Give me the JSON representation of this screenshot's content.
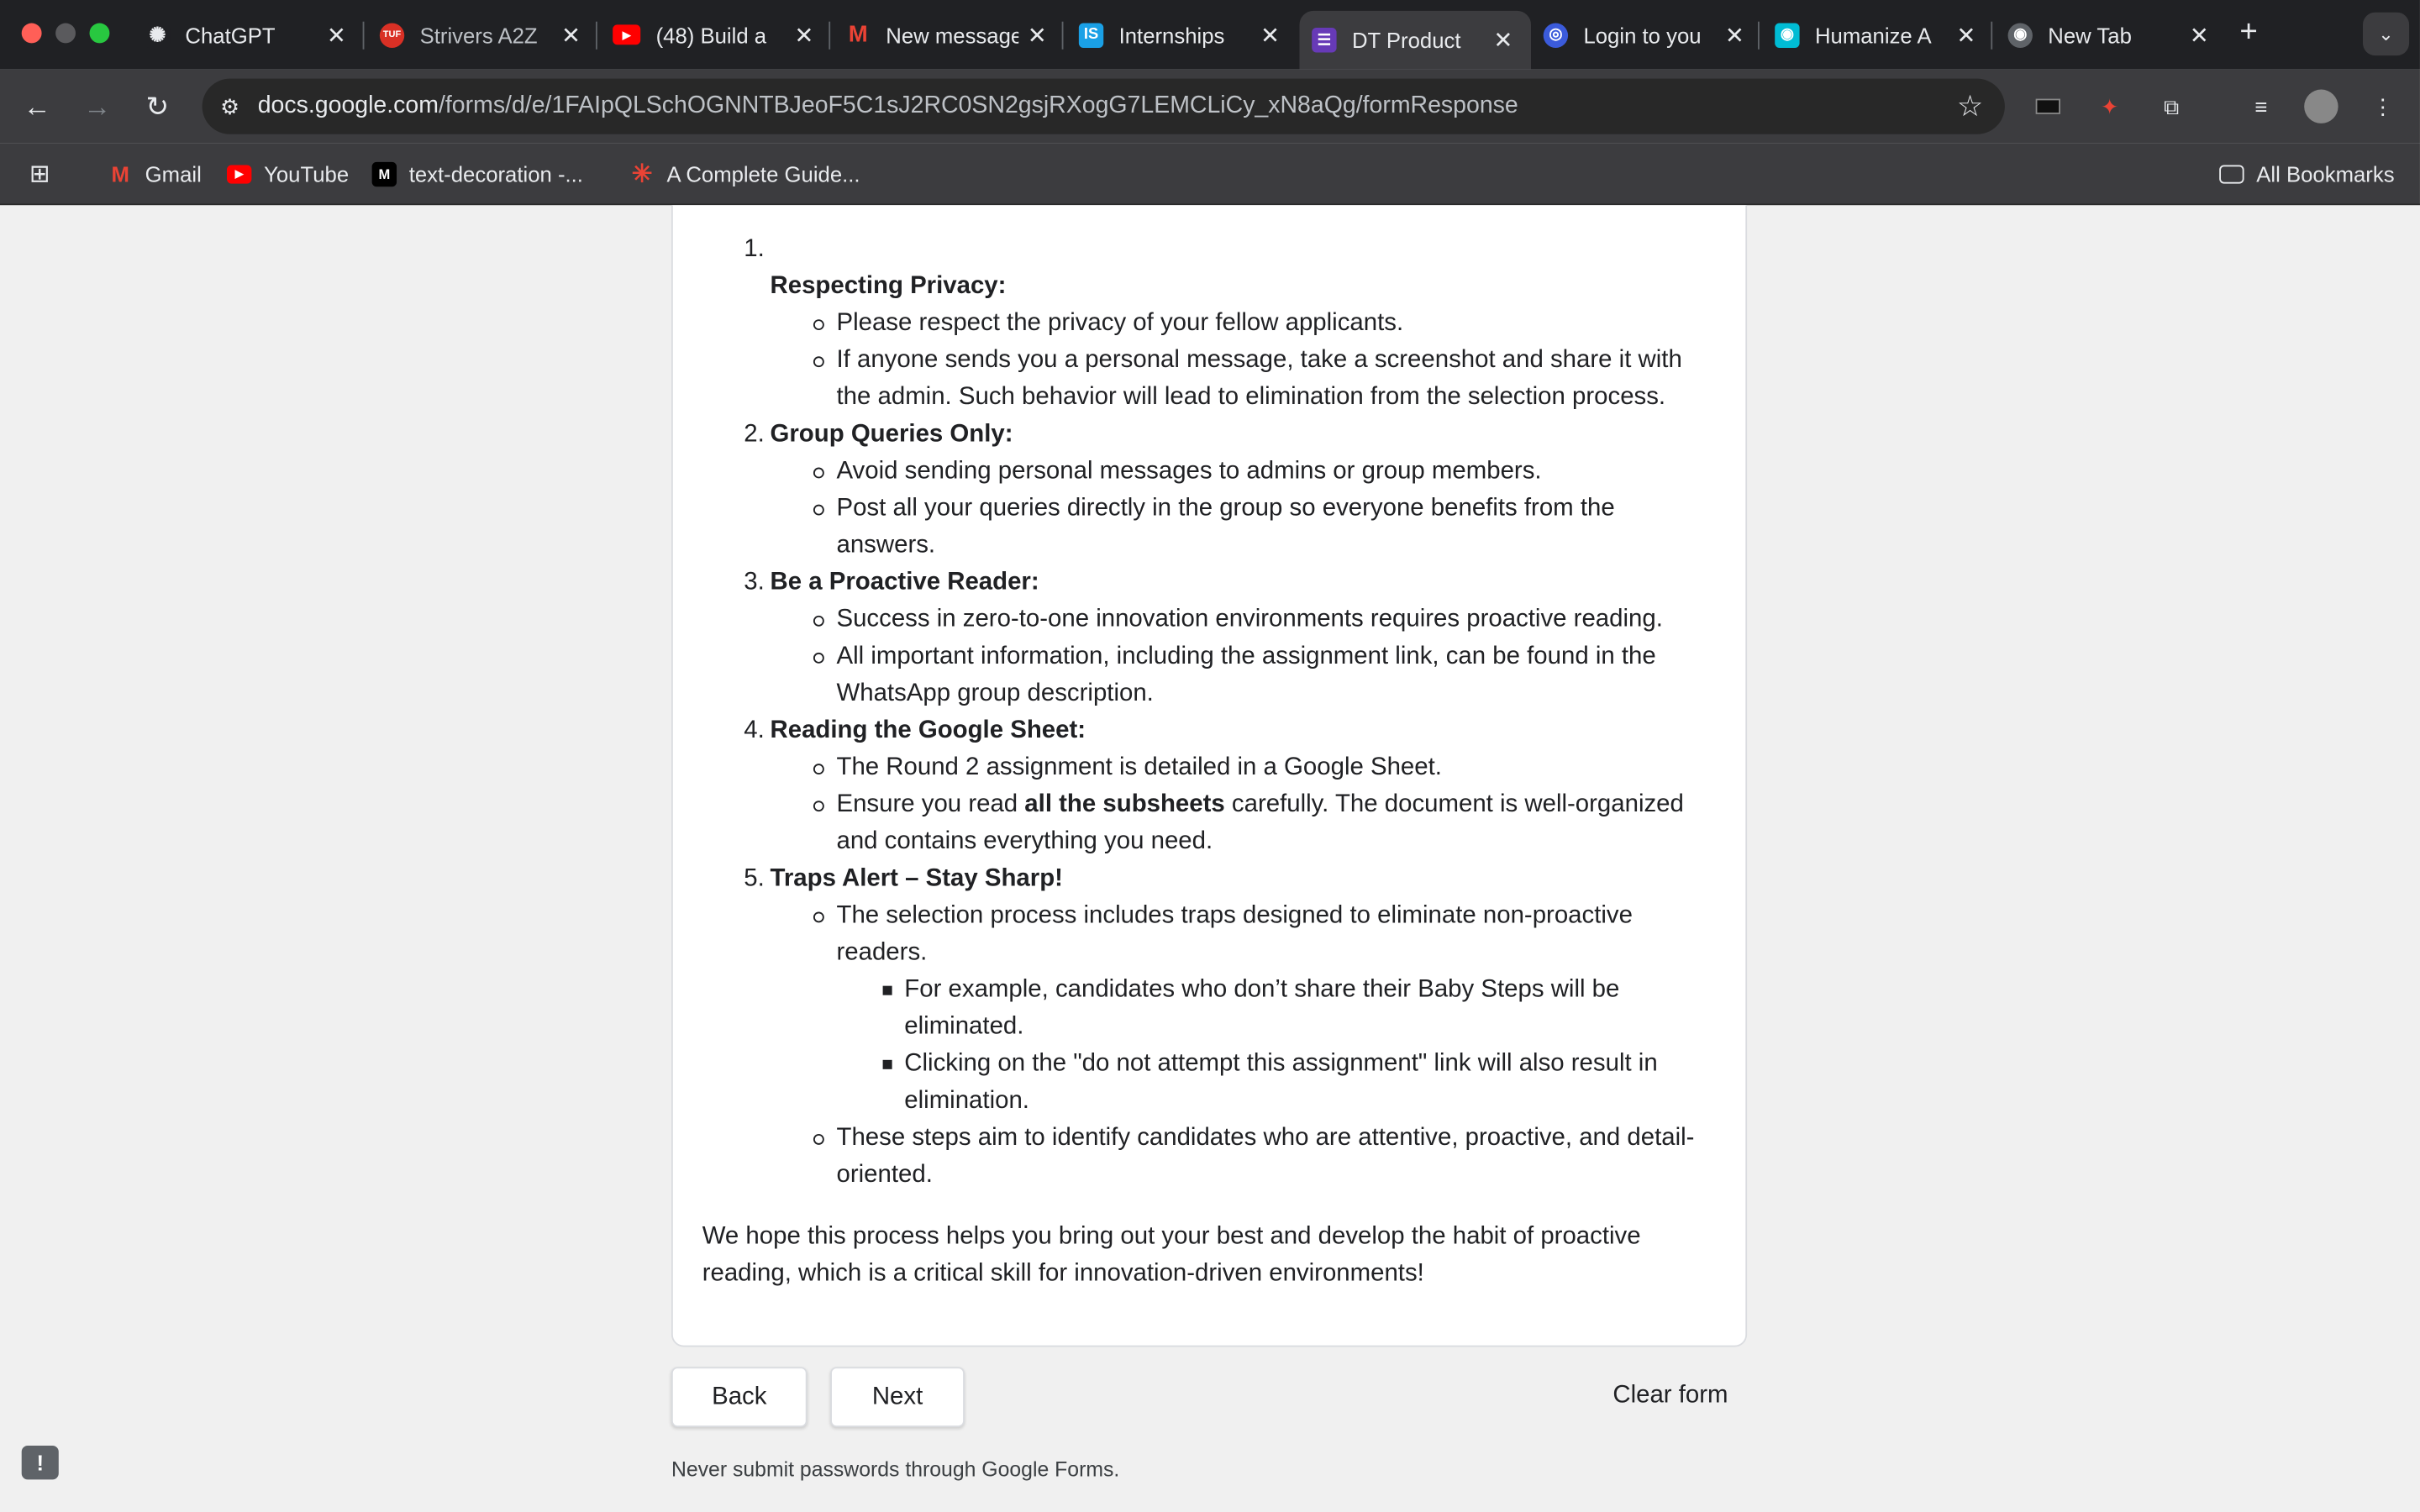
{
  "browser": {
    "tabs": [
      {
        "title": "ChatGPT",
        "icon": "chatgpt-icon",
        "color": "#202124"
      },
      {
        "title": "Strivers A2Z",
        "icon": "tuf-icon",
        "color": "#d93025"
      },
      {
        "title": "(48) Build a",
        "icon": "youtube-icon",
        "color": "#ff0000"
      },
      {
        "title": "New message",
        "icon": "gmail-icon",
        "color": "#ea4335"
      },
      {
        "title": "Internships",
        "icon": "internshala-icon",
        "color": "#1aa0e6"
      },
      {
        "title": "DT Product",
        "icon": "forms-icon",
        "color": "#673ab7"
      },
      {
        "title": "Login to you",
        "icon": "globe-icon",
        "color": "#3b5bdb"
      },
      {
        "title": "Humanize A",
        "icon": "humanize-icon",
        "color": "#00bcd4"
      },
      {
        "title": "New Tab",
        "icon": "chrome-icon",
        "color": "#5f6368"
      }
    ],
    "url_host": "docs.google.com",
    "url_path": "/forms/d/e/1FAIpQLSchOGNNTBJeoF5C1sJ2RC0SN2gsjRXogG7LEMCLiCy_xN8aQg/formResponse",
    "bookmarks": {
      "gmail": "Gmail",
      "youtube": "YouTube",
      "textdeco": "text-decoration -...",
      "guide": "A Complete Guide...",
      "all": "All Bookmarks"
    }
  },
  "form": {
    "items": [
      {
        "num": "1.",
        "title": "Respecting Privacy:",
        "bullets": [
          "Please respect the privacy of your fellow applicants.",
          "If anyone sends you a personal message, take a screenshot and share it with the admin. Such behavior will lead to elimination from the selection process."
        ]
      },
      {
        "num": "2.",
        "title": "Group Queries Only:",
        "bullets": [
          "Avoid sending personal messages to admins or group members.",
          "Post all your queries directly in the group so everyone benefits from the answers."
        ]
      },
      {
        "num": "3.",
        "title": "Be a Proactive Reader:",
        "bullets": [
          "Success in zero-to-one innovation environments requires proactive reading.",
          "All important information, including the assignment link, can be found in the WhatsApp group description."
        ]
      },
      {
        "num": "4.",
        "title": "Reading the Google Sheet:",
        "bullets": [
          "The Round 2 assignment is detailed in a Google Sheet."
        ],
        "bullet2_pre": "Ensure you read ",
        "bullet2_bold": "all the subsheets",
        "bullet2_post": " carefully. The document is well-organized and contains everything you need."
      },
      {
        "num": "5.",
        "title": "Traps Alert – Stay Sharp!",
        "bullet1": "The selection process includes traps designed to eliminate non-proactive readers.",
        "subbullets": [
          "For example, candidates who don’t share their Baby Steps will be eliminated.",
          "Clicking on the \"do not attempt this assignment\" link will also result in elimination."
        ],
        "bullet2": "These steps aim to identify candidates who are attentive, proactive, and detail-oriented."
      }
    ],
    "closing": "We hope this process helps you bring out your best and develop the habit of proactive reading, which is a critical skill for innovation-driven environments!",
    "back_label": "Back",
    "next_label": "Next",
    "clear_label": "Clear form",
    "footer_note": "Never submit passwords through Google Forms."
  }
}
